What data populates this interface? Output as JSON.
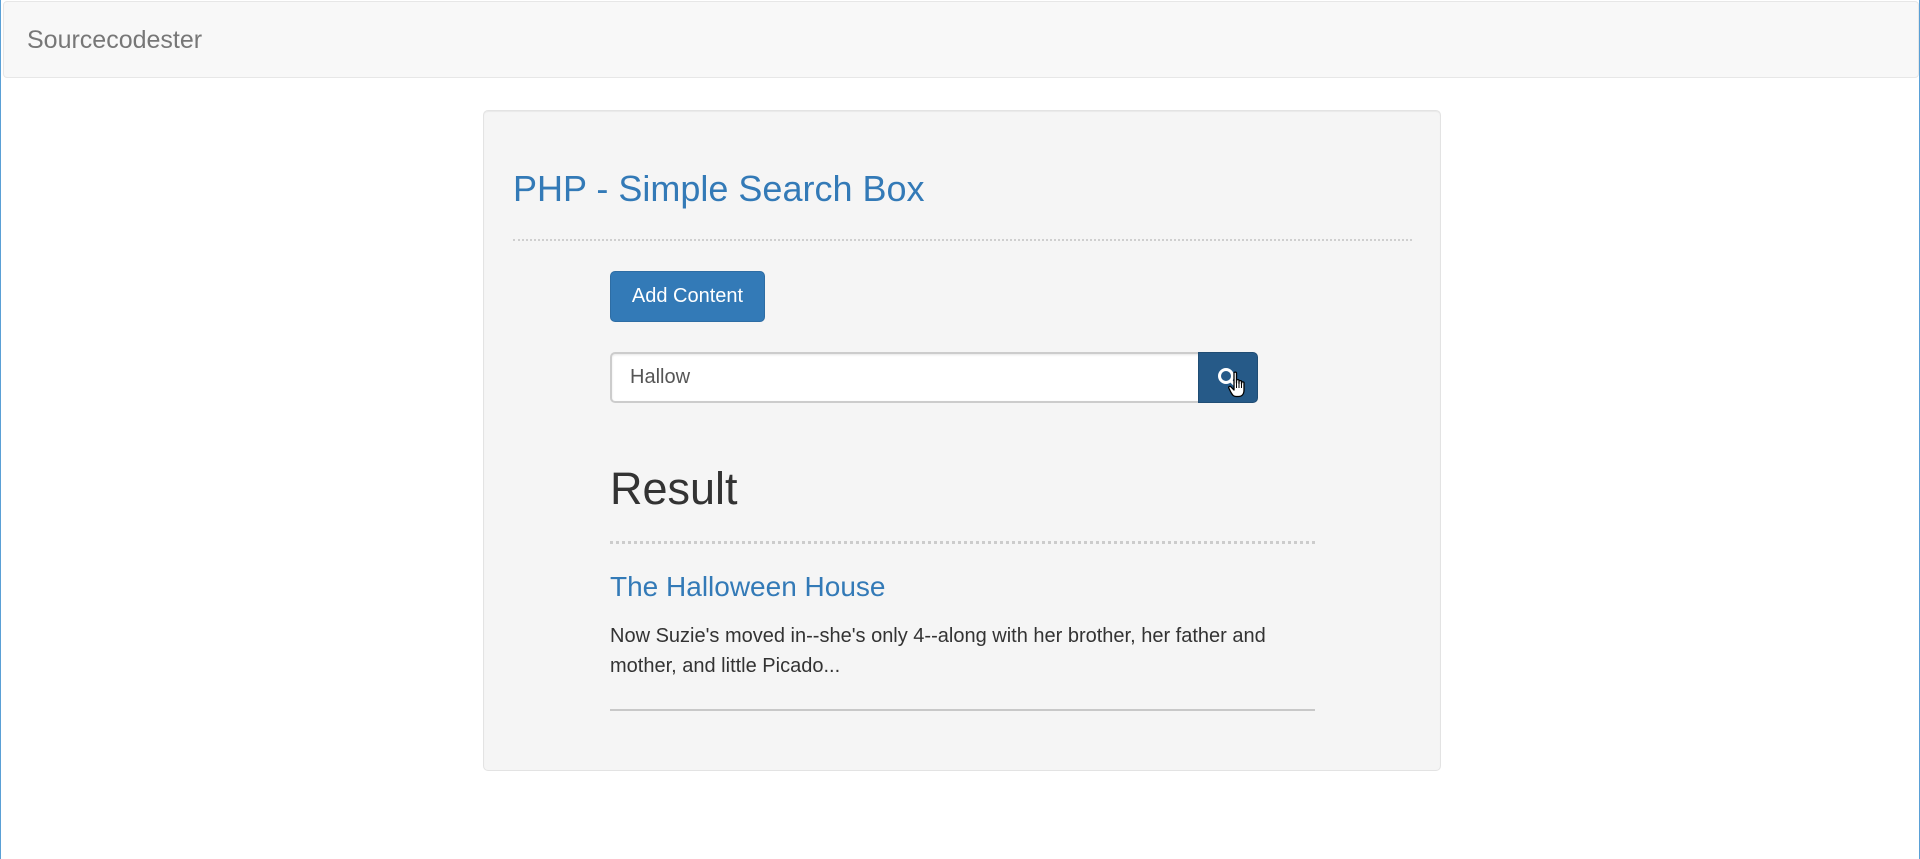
{
  "navbar": {
    "brand": "Sourcecodester"
  },
  "main": {
    "title": "PHP - Simple Search Box",
    "add_button_label": "Add Content",
    "search": {
      "value": "Hallow",
      "button_icon": "search-icon"
    },
    "result_heading": "Result",
    "results": [
      {
        "title": "The Halloween House",
        "snippet": "Now Suzie's moved in--she's only 4--along with her brother, her father and mother, and little Picado..."
      }
    ]
  },
  "colors": {
    "brand_text": "#777777",
    "link": "#337ab7",
    "button": "#337ab7",
    "search_button_active": "#265a88"
  }
}
